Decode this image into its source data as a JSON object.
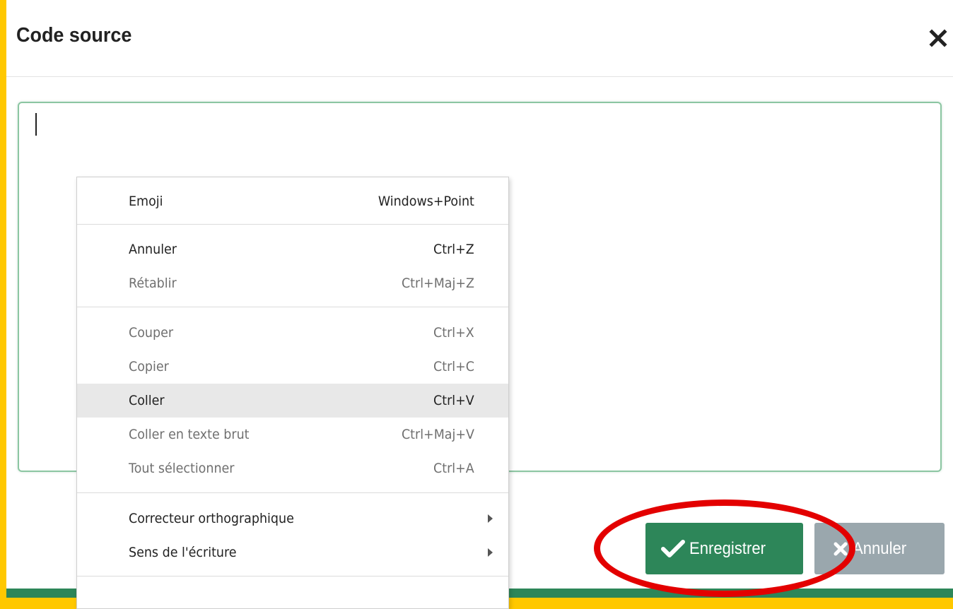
{
  "dialog": {
    "title": "Code source",
    "close_icon": "close-icon"
  },
  "editor": {
    "value": ""
  },
  "buttons": {
    "save_label": "Enregistrer",
    "save_icon": "check-icon",
    "cancel_label": "Annuler",
    "cancel_icon": "close-icon"
  },
  "colors": {
    "background": "#ffc800",
    "accent": "#2d8659",
    "cancel": "#9aa7ad",
    "annotation": "#e30000"
  },
  "context_menu": {
    "items": [
      {
        "label": "Emoji",
        "shortcut": "Windows+Point"
      },
      {
        "label": "Annuler",
        "shortcut": "Ctrl+Z"
      },
      {
        "label": "Rétablir",
        "shortcut": "Ctrl+Maj+Z"
      },
      {
        "label": "Couper",
        "shortcut": "Ctrl+X"
      },
      {
        "label": "Copier",
        "shortcut": "Ctrl+C"
      },
      {
        "label": "Coller",
        "shortcut": "Ctrl+V"
      },
      {
        "label": "Coller en texte brut",
        "shortcut": "Ctrl+Maj+V"
      },
      {
        "label": "Tout sélectionner",
        "shortcut": "Ctrl+A"
      },
      {
        "label": "Correcteur orthographique",
        "submenu_icon": "chevron-right-icon"
      },
      {
        "label": "Sens de l'écriture",
        "submenu_icon": "chevron-right-icon"
      }
    ]
  }
}
